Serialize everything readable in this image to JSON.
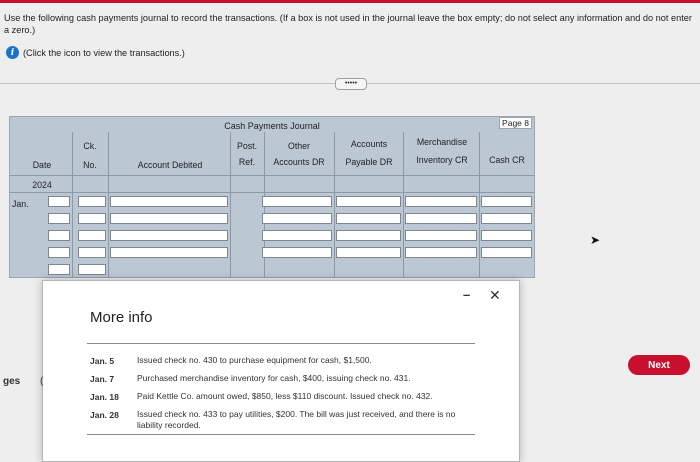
{
  "instructions": "Use the following cash payments journal to record the transactions. (If a box is not used in the journal leave the box empty; do not select any information and do not enter a zero.)",
  "info_link": "(Click the icon to view the transactions.)",
  "expand_button": "•••••",
  "journal": {
    "title": "Cash Payments Journal",
    "page": "Page 8",
    "headers": {
      "date": "Date",
      "ck_top": "Ck.",
      "ck_bottom": "No.",
      "account_debited": "Account Debited",
      "post_top": "Post.",
      "post_bottom": "Ref.",
      "other_top": "Other",
      "other_bottom": "Accounts DR",
      "ap_top": "Accounts",
      "ap_bottom": "Payable DR",
      "merch_top": "Merchandise",
      "merch_bottom": "Inventory CR",
      "cash": "Cash CR"
    },
    "year": "2024",
    "month": "Jan."
  },
  "modal": {
    "title": "More info",
    "minimize": "–",
    "close": "✕",
    "transactions": [
      {
        "date": "Jan. 5",
        "desc": "Issued check no. 430 to purchase equipment for cash, $1,500."
      },
      {
        "date": "Jan. 7",
        "desc": "Purchased merchandise inventory for cash, $400, issuing check no. 431."
      },
      {
        "date": "Jan. 18",
        "desc": "Paid Kettle Co. amount owed, $850, less $110 discount. Issued check no. 432."
      },
      {
        "date": "Jan. 28",
        "desc": "Issued check no. 433 to pay utilities, $200. The bill was just received, and there is no liability recorded."
      }
    ]
  },
  "left_fragment": "ges",
  "left_fragment2": "(",
  "next_button": "Next"
}
